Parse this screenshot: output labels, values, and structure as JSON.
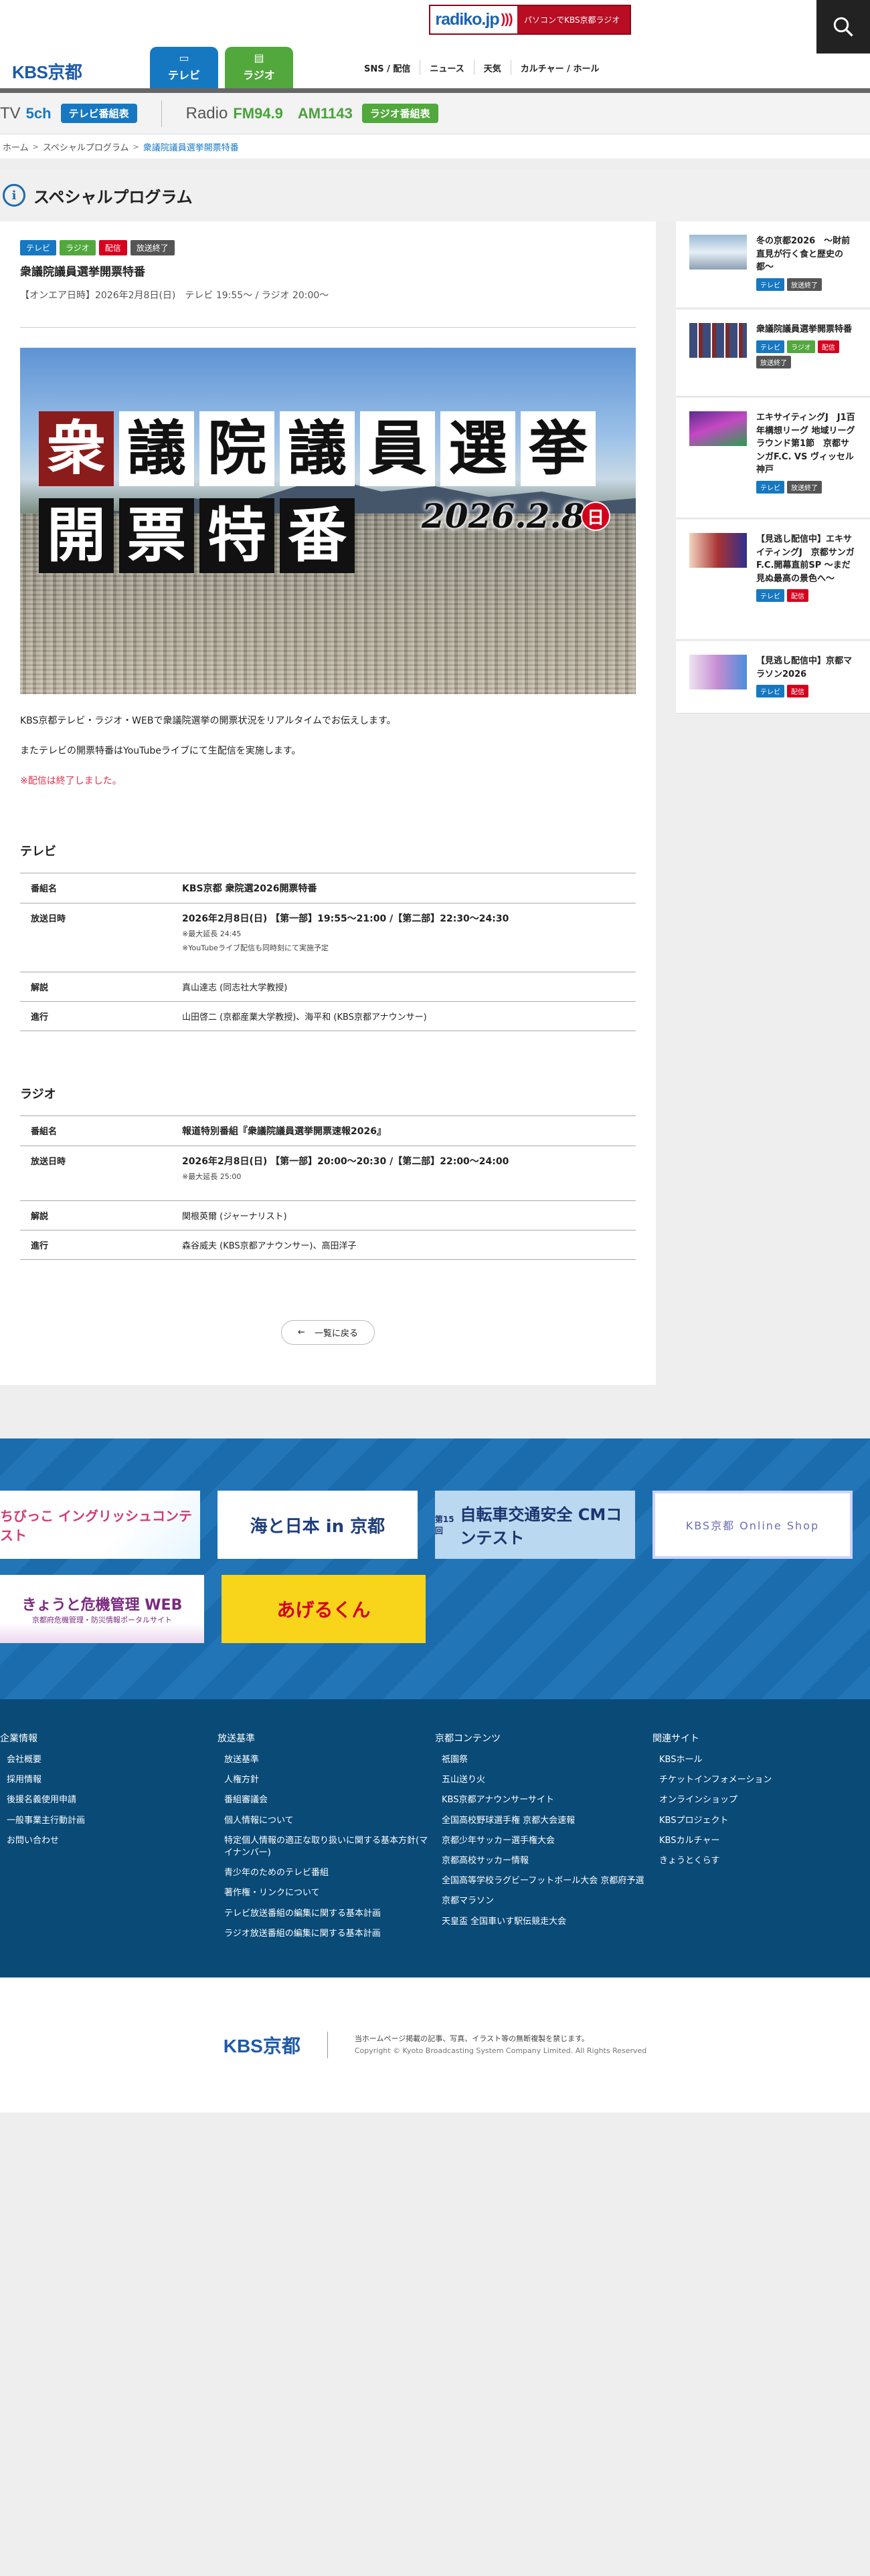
{
  "header": {
    "radiko_logo": "radiko.jp",
    "radiko_text": "パソコンでKBS京都ラジオ",
    "logo": "KBS京都",
    "tab_tv": "テレビ",
    "tab_radio": "ラジオ",
    "nav": [
      "SNS / 配信",
      "ニュース",
      "天気",
      "カルチャー / ホール"
    ]
  },
  "onair": {
    "tv_label": "TV",
    "tv_ch": "5ch",
    "tv_button": "テレビ番組表",
    "radio_label": "Radio",
    "fm": "FM94.9",
    "am": "AM1143",
    "radio_button": "ラジオ番組表"
  },
  "breadcrumb": [
    "ホーム",
    "スペシャルプログラム",
    "衆議院議員選挙開票特番"
  ],
  "section_title": "スペシャルプログラム",
  "program": {
    "tags": [
      "テレビ",
      "ラジオ",
      "配信",
      "放送終了"
    ],
    "title": "衆議院議員選挙開票特番",
    "onair_date": "【オンエア日時】2026年2月8日(日)　テレビ 19:55〜 / ラジオ 20:00〜",
    "hero_row1": [
      "衆",
      "議",
      "院",
      "議",
      "員",
      "選",
      "挙"
    ],
    "hero_row2": [
      "開",
      "票",
      "特",
      "番"
    ],
    "hero_date": "2026.2.8",
    "hero_day": "日",
    "desc1": "KBS京都テレビ・ラジオ・WEBで衆議院選挙の開票状況をリアルタイムでお伝えします。",
    "desc2": "またテレビの開票特番はYouTubeライブにて生配信を実施します。",
    "notice": "※配信は終了しました。"
  },
  "tv_table": {
    "heading": "テレビ",
    "rows": [
      {
        "k": "番組名",
        "v": "KBS京都 衆院選2026開票特番"
      },
      {
        "k": "放送日時",
        "v": "2026年2月8日(日) 【第一部】19:55〜21:00 /【第二部】22:30〜24:30",
        "note1": "※最大延長 24:45",
        "note2": "※YouTubeライブ配信も同時刻にて実施予定"
      },
      {
        "k": "解説",
        "v": "真山達志 (同志社大学教授)"
      },
      {
        "k": "進行",
        "v": "山田啓二 (京都産業大学教授)、海平和 (KBS京都アナウンサー)"
      }
    ]
  },
  "radio_table": {
    "heading": "ラジオ",
    "rows": [
      {
        "k": "番組名",
        "v": "報道特別番組『衆議院議員選挙開票速報2026』"
      },
      {
        "k": "放送日時",
        "v": "2026年2月8日(日) 【第一部】20:00〜20:30 /【第二部】22:00〜24:00",
        "note1": "※最大延長 25:00"
      },
      {
        "k": "解説",
        "v": "関根英爾 (ジャーナリスト)"
      },
      {
        "k": "進行",
        "v": "森谷威夫 (KBS京都アナウンサー)、高田洋子"
      }
    ]
  },
  "back_button": "一覧に戻る",
  "sidebar": [
    {
      "title": "冬の京都2026　〜財前直見が行く食と歴史の都〜",
      "tags": [
        "テレビ",
        "放送終了"
      ]
    },
    {
      "title": "衆議院議員選挙開票特番",
      "tags": [
        "テレビ",
        "ラジオ",
        "配信",
        "放送終了"
      ]
    },
    {
      "title": "エキサイティングJ　J1百年構想リーグ 地域リーグラウンド第1節　京都サンガF.C. VS ヴィッセル神戸",
      "tags": [
        "テレビ",
        "放送終了"
      ]
    },
    {
      "title": "【見逃し配信中】エキサイティングJ　京都サンガF.C.開幕直前SP 〜まだ見ぬ最高の景色へ〜",
      "tags": [
        "テレビ",
        "配信"
      ]
    },
    {
      "title": "【見逃し配信中】京都マラソン2026",
      "tags": [
        "テレビ",
        "配信"
      ]
    }
  ],
  "banners": {
    "english": "ちびっこ イングリッシュコンテスト",
    "umi": "海と日本 in 京都",
    "bike_top": "第15回",
    "bike": "自転車交通安全 CMコンテスト",
    "shop": "KBS京都 Online Shop",
    "kiki": "きょうと危機管理 WEB",
    "kiki_sub": "京都府危機管理・防災情報ポータルサイト",
    "ageru": "あげるくん"
  },
  "footer": {
    "cols": [
      {
        "title": "企業情報",
        "items": [
          "会社概要",
          "採用情報",
          "後援名義使用申請",
          "一般事業主行動計画",
          "お問い合わせ"
        ]
      },
      {
        "title": "放送基準",
        "items": [
          "放送基準",
          "人権方針",
          "番組審議会",
          "個人情報について",
          "特定個人情報の適正な取り扱いに関する基本方針(マイナンバー)",
          "青少年のためのテレビ番組",
          "著作権・リンクについて",
          "テレビ放送番組の編集に関する基本計画",
          "ラジオ放送番組の編集に関する基本計画"
        ]
      },
      {
        "title": "京都コンテンツ",
        "items": [
          "祇園祭",
          "五山送り火",
          "KBS京都アナウンサーサイト",
          "全国高校野球選手権 京都大会速報",
          "京都少年サッカー選手権大会",
          "京都高校サッカー情報",
          "全国高等学校ラグビーフットボール大会 京都府予選",
          "京都マラソン",
          "天皇盃 全国車いす駅伝競走大会"
        ]
      },
      {
        "title": "関連サイト",
        "items": [
          "KBSホール",
          "チケットインフォメーション",
          "オンラインショップ",
          "KBSプロジェクト",
          "KBSカルチャー",
          "きょうとくらす"
        ]
      }
    ],
    "logo": "KBS京都",
    "notice": "当ホームページ掲載の記事、写真、イラスト等の無断複製を禁じます。",
    "copyright": "Copyright © Kyoto Broadcasting System Company Limited. All Rights Reserved"
  },
  "colors": {
    "tv": "#1778c2",
    "radio": "#52a83c",
    "live": "#d6001c",
    "ended": "#555555",
    "footer": "#094a77"
  }
}
